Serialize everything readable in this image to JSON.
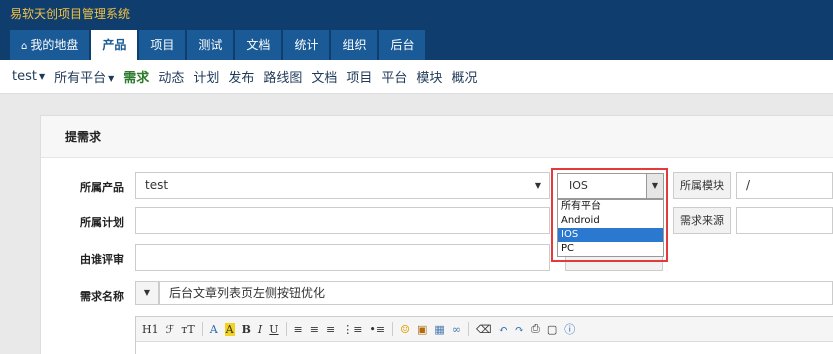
{
  "app": {
    "title": "易软天创项目管理系统"
  },
  "main_nav": [
    {
      "label": "我的地盘",
      "icon": "home-icon"
    },
    {
      "label": "产品",
      "active": true
    },
    {
      "label": "项目"
    },
    {
      "label": "测试"
    },
    {
      "label": "文档"
    },
    {
      "label": "统计"
    },
    {
      "label": "组织"
    },
    {
      "label": "后台"
    }
  ],
  "sub_nav": [
    {
      "label": "test",
      "dropdown": true
    },
    {
      "label": "所有平台",
      "dropdown": true
    },
    {
      "label": "需求",
      "active": true
    },
    {
      "label": "动态"
    },
    {
      "label": "计划"
    },
    {
      "label": "发布"
    },
    {
      "label": "路线图"
    },
    {
      "label": "文档"
    },
    {
      "label": "项目"
    },
    {
      "label": "平台"
    },
    {
      "label": "模块"
    },
    {
      "label": "概况"
    }
  ],
  "form": {
    "heading": "提需求",
    "product_label": "所属产品",
    "product_value": "test",
    "platform_value": "IOS",
    "platform_options": [
      "所有平台",
      "Android",
      "IOS",
      "PC"
    ],
    "platform_selected": "IOS",
    "module_label": "所属模块",
    "module_value": "/",
    "plan_label": "所属计划",
    "source_label": "需求来源",
    "reviewer_label": "由谁评审",
    "title_label": "需求名称",
    "title_value": "后台文章列表页左侧按钮优化"
  },
  "editor_toolbar": [
    "H1",
    "ℱ",
    "тT",
    "A",
    "A",
    "B",
    "I",
    "U"
  ],
  "colors": {
    "header_bg": "#0f3e6e",
    "title_color": "#f5c242",
    "tab_bg": "#1a5a96",
    "active_subnav": "#2c7a2c",
    "highlight": "#e23b3b",
    "selected_option": "#2a78d0"
  }
}
